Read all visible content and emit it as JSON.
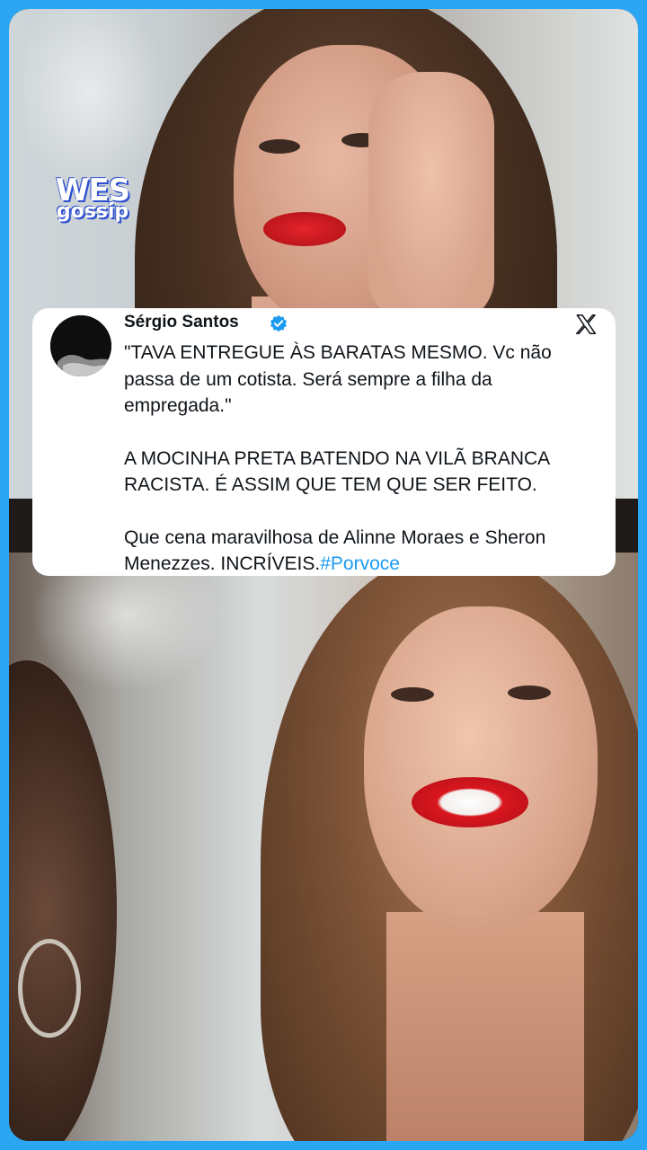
{
  "watermark": {
    "line1": "WES",
    "line2": "gossip"
  },
  "tweet": {
    "author": "Sérgio Santos",
    "verified": true,
    "verified_badge_color": "#1d9bf0",
    "platform_icon": "x-logo-icon",
    "paragraph1": "\"TAVA ENTREGUE ÀS BARATAS MESMO. Vc não passa de um cotista. Será sempre a filha da empregada.\"",
    "paragraph2": "A MOCINHA PRETA BATENDO NA VILÃ BRANCA RACISTA. É ASSIM QUE TEM QUE SER FEITO.",
    "paragraph3_text": "Que cena maravilhosa de Alinne Moraes e Sheron Menezzes. INCRÍVEIS.",
    "hashtag": "#Porvoce",
    "hashtag_color": "#1d9bf0"
  },
  "colors": {
    "border": "#2aa6f2",
    "card_background": "#ffffff",
    "text": "#0f1419"
  }
}
